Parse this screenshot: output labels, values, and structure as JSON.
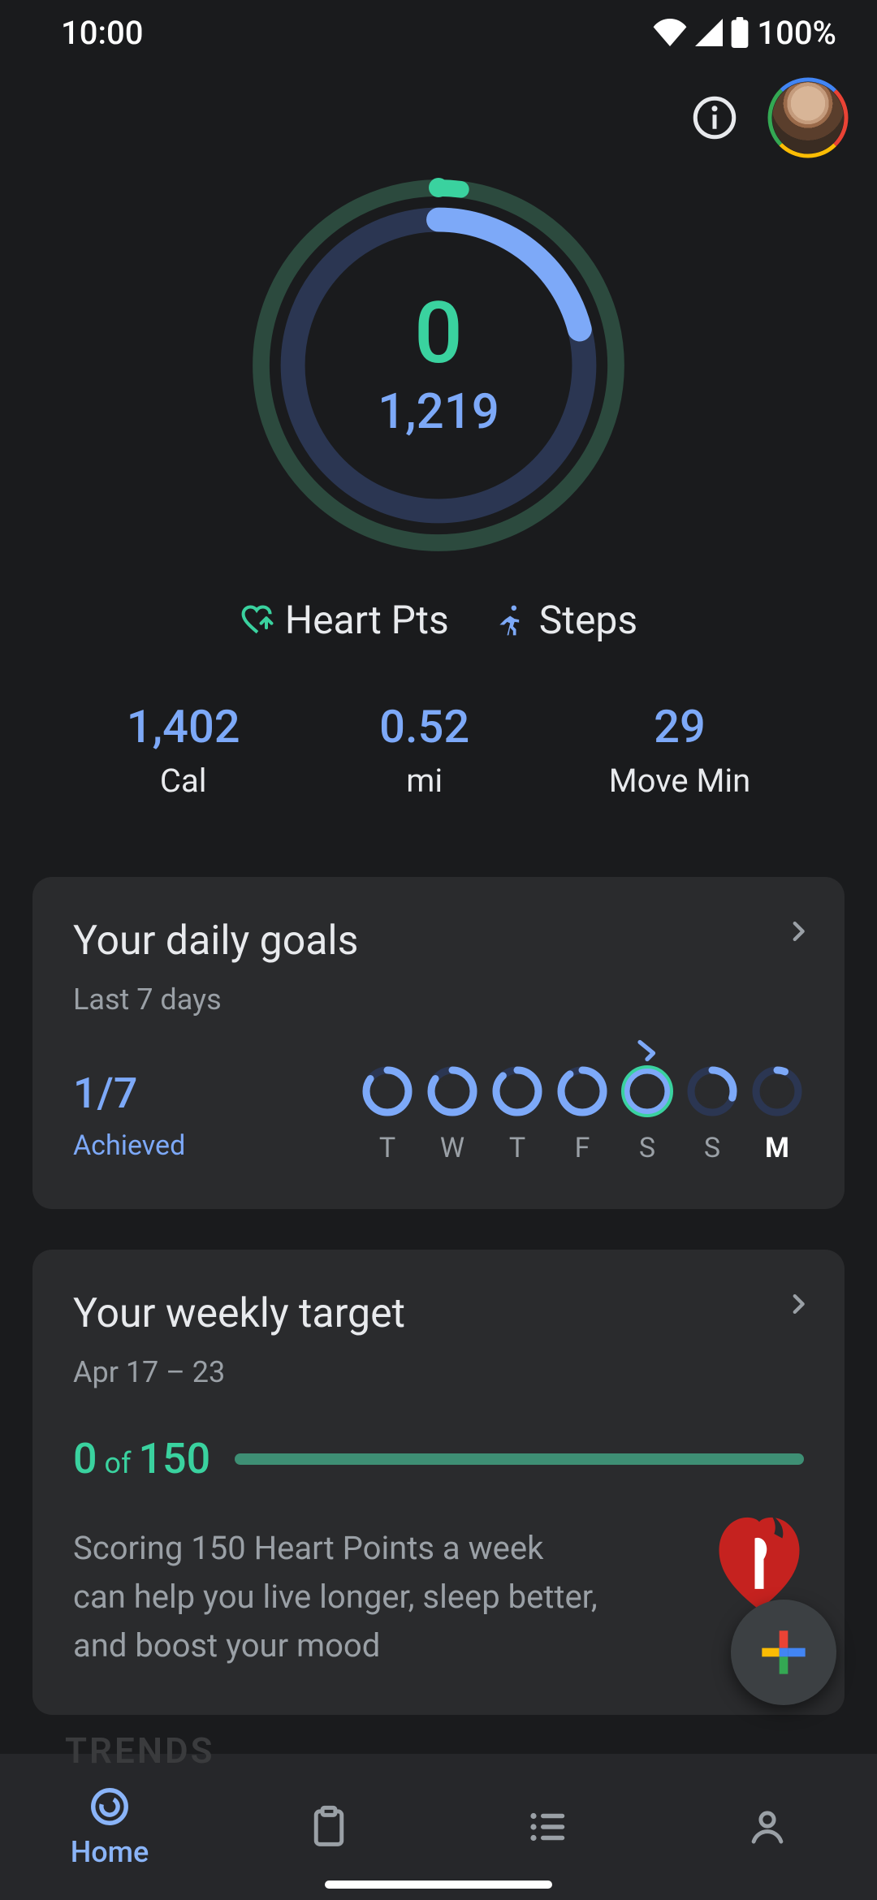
{
  "status": {
    "time": "10:00",
    "battery": "100%"
  },
  "ring": {
    "heart_points": "0",
    "steps": "1,219",
    "heart_progress": 0.02,
    "steps_progress": 0.21
  },
  "legend": {
    "heart": "Heart Pts",
    "steps": "Steps"
  },
  "stats": {
    "cal": {
      "value": "1,402",
      "label": "Cal"
    },
    "mi": {
      "value": "0.52",
      "label": "mi"
    },
    "move": {
      "value": "29",
      "label": "Move Min"
    }
  },
  "daily_goals": {
    "title": "Your daily goals",
    "subtitle": "Last 7 days",
    "fraction": "1/7",
    "achieved_label": "Achieved",
    "days": [
      {
        "label": "T",
        "steps_prog": 0.85,
        "heart_prog": 0.0,
        "checked": false,
        "today": false
      },
      {
        "label": "W",
        "steps_prog": 0.85,
        "heart_prog": 0.0,
        "checked": false,
        "today": false
      },
      {
        "label": "T",
        "steps_prog": 0.88,
        "heart_prog": 0.0,
        "checked": false,
        "today": false
      },
      {
        "label": "F",
        "steps_prog": 0.9,
        "heart_prog": 0.0,
        "checked": false,
        "today": false
      },
      {
        "label": "S",
        "steps_prog": 1.0,
        "heart_prog": 1.0,
        "checked": true,
        "today": false
      },
      {
        "label": "S",
        "steps_prog": 0.3,
        "heart_prog": 0.0,
        "checked": false,
        "today": false
      },
      {
        "label": "M",
        "steps_prog": 0.06,
        "heart_prog": 0.0,
        "checked": false,
        "today": true
      }
    ]
  },
  "weekly": {
    "title": "Your weekly target",
    "subtitle": "Apr 17 – 23",
    "score_current": "0",
    "score_of": " of ",
    "score_total": "150",
    "description": "Scoring 150 Heart Points a week can help you live longer, sleep better, and boost your mood"
  },
  "trends_ghost": "TRENDS",
  "nav": {
    "home": "Home"
  }
}
